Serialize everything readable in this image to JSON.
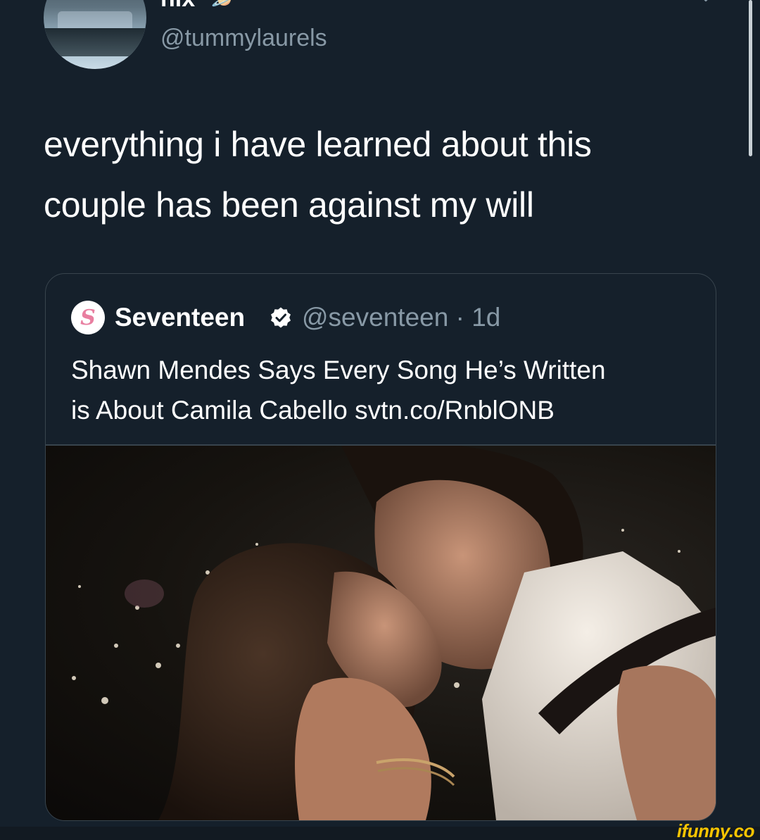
{
  "author": {
    "display_name": "nix",
    "badge_icon": "saturn-emoji-icon",
    "handle": "@tummylaurels"
  },
  "tweet": {
    "line1": "everything i have learned about this",
    "line2": "couple has been against my will"
  },
  "quoted_tweet": {
    "name": "Seventeen",
    "avatar_letter": "S",
    "verified_icon": "verified-badge-icon",
    "handle": "@seventeen",
    "separator": "·",
    "age": "1d",
    "line1": "Shawn Mendes Says Every Song He’s Written",
    "line2": "is About Camila Cabello svtn.co/RnblONB"
  },
  "watermark": "ifunny.co",
  "colors": {
    "background": "#15202b",
    "text_primary": "#ffffff",
    "text_secondary": "#8899a6",
    "border": "#38444d",
    "watermark": "#f8c400",
    "seventeen_brand": "#e87fa0"
  }
}
